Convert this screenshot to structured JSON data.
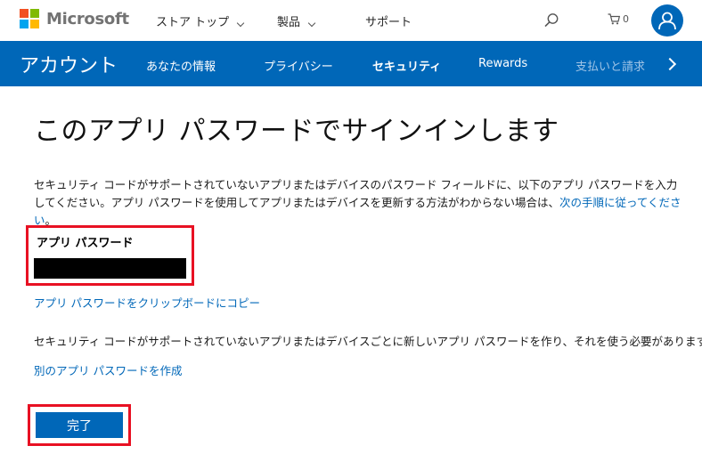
{
  "header": {
    "brand": "Microsoft",
    "logo_colors": [
      "#f25022",
      "#7fba00",
      "#00a4ef",
      "#ffb900"
    ],
    "nav": [
      {
        "label": "ストア トップ",
        "has_dropdown": true
      },
      {
        "label": "製品",
        "has_dropdown": true
      },
      {
        "label": "サポート",
        "has_dropdown": false
      }
    ],
    "cart_count": "0",
    "icons": {
      "search": "search-icon",
      "cart": "cart-icon",
      "account": "user-avatar-icon"
    }
  },
  "account_nav": {
    "title": "アカウント",
    "items": [
      {
        "label": "あなたの情報",
        "active": false
      },
      {
        "label": "プライバシー",
        "active": false
      },
      {
        "label": "セキュリティ",
        "active": true
      },
      {
        "label": "Rewards",
        "active": false
      },
      {
        "label": "支払いと請求",
        "active": false
      }
    ],
    "accent": "#0067b8"
  },
  "main": {
    "title": "このアプリ パスワードでサインインします",
    "intro_text": "セキュリティ コードがサポートされていないアプリまたはデバイスのパスワード フィールドに、以下のアプリ パスワードを入力してください。アプリ パスワードを使用してアプリまたはデバイスを更新する方法がわからない場合は、",
    "intro_link": "次の手順に従ってください",
    "intro_end": "。",
    "password_label": "アプリ パスワード",
    "password_value": "",
    "copy_link": "アプリ パスワードをクリップボードにコピー",
    "info_text": "セキュリティ コードがサポートされていないアプリまたはデバイスごとに新しいアプリ パスワードを作り、それを使う必要があります。",
    "create_link": "別のアプリ パスワードを作成",
    "done_button": "完了",
    "highlight_color": "#e81123"
  }
}
